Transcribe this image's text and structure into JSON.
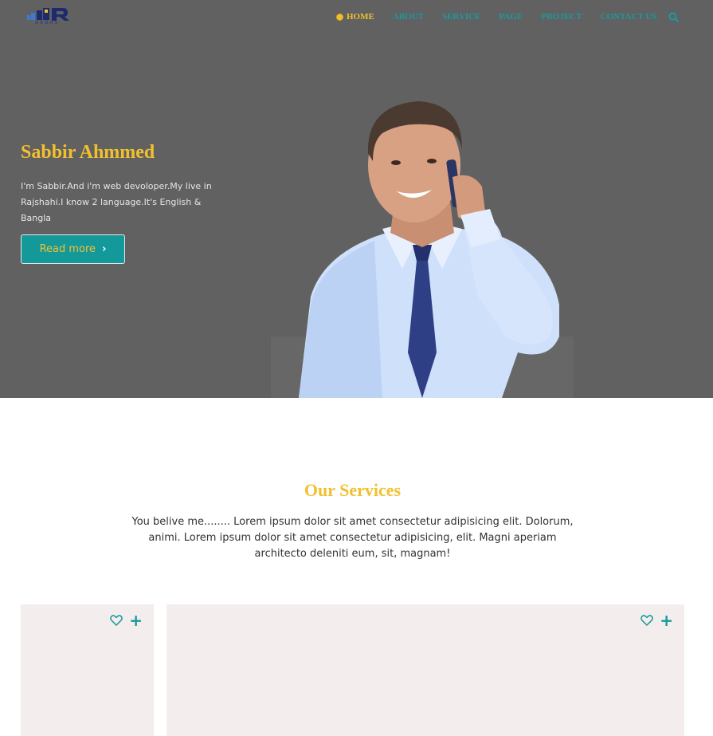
{
  "brand": {
    "logo_text": "ABBAS",
    "colors": {
      "accent": "#f2c02f",
      "teal": "#14999b",
      "hero_bg": "#616161",
      "card_bg": "#f3eded"
    }
  },
  "nav": {
    "items": [
      {
        "label": "HOME",
        "active": true
      },
      {
        "label": "ABOUT"
      },
      {
        "label": "SERVICE"
      },
      {
        "label": "PAGE"
      },
      {
        "label": "PROJECT"
      },
      {
        "label": "CONTACT US"
      }
    ],
    "search_icon": "search-icon"
  },
  "hero": {
    "title": "Sabbir Ahmmed",
    "description": "I'm Sabbir.And i'm web devoloper.My live in Rajshahi.I know 2 language.It's English & Bangla",
    "button_label": "Read more",
    "button_icon": "chevron-right-icon"
  },
  "services": {
    "title": "Our Services",
    "description": "You belive me........ Lorem ipsum dolor sit amet consectetur adipisicing elit. Dolorum, animi. Lorem ipsum dolor sit amet consectetur adipisicing, elit. Magni aperiam architecto deleniti eum, sit, magnam!",
    "cards": [
      {
        "icons": [
          "heart-icon",
          "plus-icon"
        ],
        "plus": "+"
      },
      {
        "icons": [
          "heart-icon",
          "plus-icon"
        ],
        "plus": "+"
      }
    ]
  }
}
